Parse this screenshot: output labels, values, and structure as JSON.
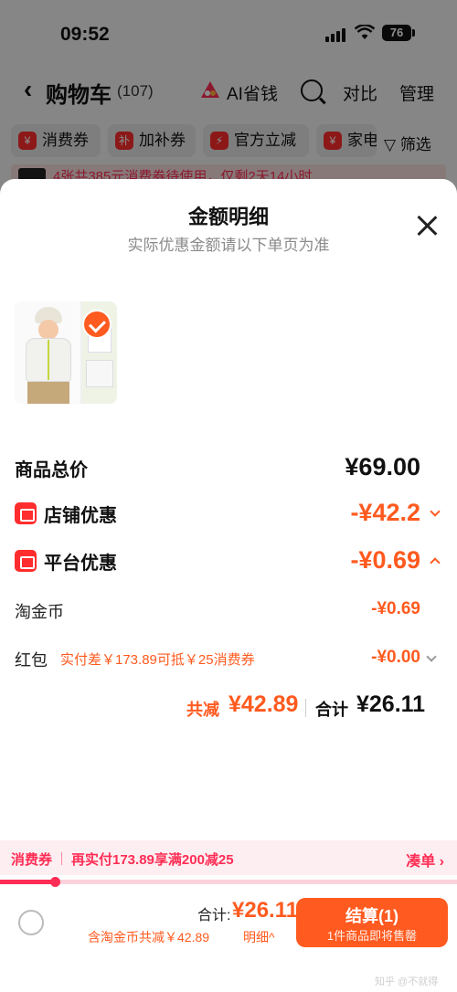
{
  "status_bar": {
    "time": "09:52",
    "battery": "76"
  },
  "nav": {
    "back_icon": "chevron-left-icon",
    "title": "购物车",
    "count": "(107)",
    "ai_label": "AI省钱",
    "compare": "对比",
    "manage": "管理"
  },
  "filter_chips": [
    {
      "icon": "¥",
      "label": "消费券"
    },
    {
      "icon": "补",
      "label": "加补券"
    },
    {
      "icon": "⚡",
      "label": "官方立减"
    },
    {
      "icon": "¥",
      "label": "家电"
    }
  ],
  "filter_label": "筛选",
  "notice_strip": "4张共385元消费券待使用，仅剩2天14小时",
  "sheet": {
    "title": "金额明细",
    "subtitle": "实际优惠金额请以下单页为准",
    "rows": {
      "goods_total": {
        "label": "商品总价",
        "value": "¥69.00"
      },
      "shop_discount": {
        "label": "店铺优惠",
        "value": "-¥42.2"
      },
      "platform_discount": {
        "label": "平台优惠",
        "value": "-¥0.69"
      }
    },
    "sub_rows": {
      "coins": {
        "label": "淘金币",
        "value": "-¥0.69"
      },
      "red_packet": {
        "label": "红包",
        "note": "实付差￥173.89可抵￥25消费券",
        "value": "-¥0.00"
      }
    },
    "summary": {
      "saved_label": "共减",
      "saved_value": "¥42.89",
      "total_label": "合计",
      "total_value": "¥26.11"
    }
  },
  "coupon_bar": {
    "tag": "消费券",
    "text": "再实付173.89享满200减25",
    "link": "凑单 ›",
    "progress": 0.12
  },
  "bottom": {
    "total_label": "合计:",
    "total_value": "¥26.11",
    "saved_text": "含淘金币共减￥42.89",
    "detail_link": "明细^",
    "checkout_label": "结算(1)",
    "checkout_sub": "1件商品即将售罄"
  },
  "watermark": "知乎 @不就得",
  "colors": {
    "accent": "#ff5a1f",
    "coupon_red": "#ff2d55"
  }
}
